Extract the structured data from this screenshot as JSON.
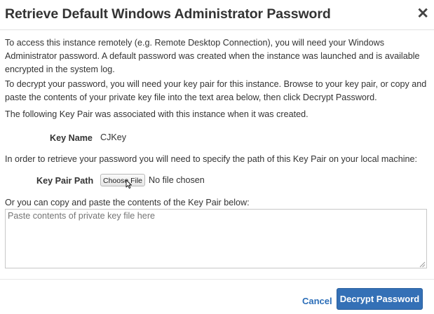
{
  "dialog": {
    "title": "Retrieve Default Windows Administrator Password",
    "close_glyph": "✕"
  },
  "intro": {
    "text": "To access this instance remotely (e.g. Remote Desktop Connection), you will need your Windows Administrator password. A default password was created when the instance was launched and is available encrypted in the system log."
  },
  "decrypt_instructions": {
    "text": "To decrypt your password, you will need your key pair for this instance. Browse to your key pair, or copy and paste the contents of your private key file into the text area below, then click Decrypt Password."
  },
  "association_note": {
    "text": "The following Key Pair was associated with this instance when it was created."
  },
  "key_name": {
    "label": "Key Name",
    "value": "CJKey"
  },
  "path_instructions": {
    "text": "In order to retrieve your password you will need to specify the path of this Key Pair on your local machine:"
  },
  "key_pair_path": {
    "label": "Key Pair Path",
    "button_label": "Choose File",
    "status": "No file chosen"
  },
  "paste_section": {
    "label": "Or you can copy and paste the contents of the Key Pair below:",
    "placeholder": "Paste contents of private key file here",
    "value": ""
  },
  "footer": {
    "cancel_label": "Cancel",
    "decrypt_label": "Decrypt Password"
  },
  "colors": {
    "primary_button": "#3470b6",
    "link": "#2c6eb8",
    "text": "#333333"
  }
}
